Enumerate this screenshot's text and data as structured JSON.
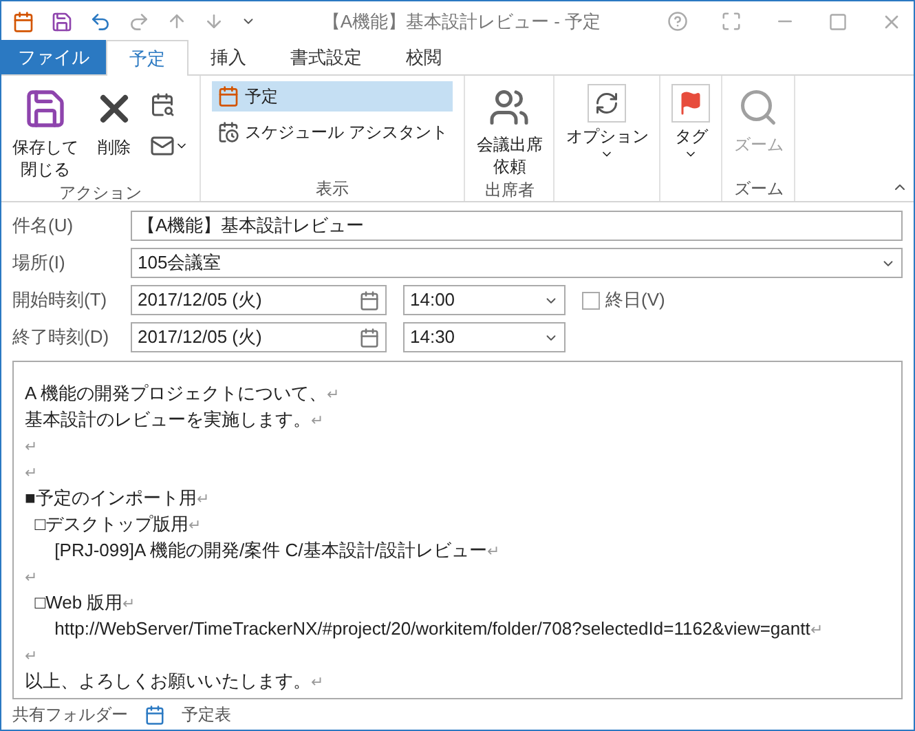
{
  "window": {
    "title": "【A機能】基本設計レビュー - 予定"
  },
  "ribbon_tabs": [
    {
      "label": "ファイル",
      "kind": "file",
      "selected": false
    },
    {
      "label": "予定",
      "kind": "tab",
      "selected": true
    },
    {
      "label": "挿入",
      "kind": "tab",
      "selected": false
    },
    {
      "label": "書式設定",
      "kind": "tab",
      "selected": false
    },
    {
      "label": "校閲",
      "kind": "tab",
      "selected": false
    }
  ],
  "ribbon_groups": [
    {
      "label": "アクション",
      "items": [
        {
          "kind": "save",
          "label": [
            "保存して",
            "閉じる"
          ]
        },
        {
          "kind": "delete",
          "label": "削除"
        },
        {
          "kind": "small-icons"
        }
      ]
    },
    {
      "label": "表示",
      "items": [
        {
          "kind": "view",
          "label": "予定",
          "selected": true
        },
        {
          "kind": "view",
          "label": "スケジュール アシスタント",
          "selected": false
        }
      ]
    },
    {
      "label": "出席者",
      "items": [
        {
          "kind": "meeting",
          "label": [
            "会議出席",
            "依頼"
          ]
        }
      ]
    },
    {
      "items": [
        {
          "kind": "options",
          "label": "オプション"
        }
      ]
    },
    {
      "items": [
        {
          "kind": "tags",
          "label": "タグ"
        }
      ]
    },
    {
      "label": "ズーム",
      "items": [
        {
          "kind": "zoom",
          "label": "ズーム",
          "disabled": true
        }
      ]
    }
  ],
  "form": {
    "subject": {
      "label": "件名(U)",
      "value": "【A機能】基本設計レビュー"
    },
    "location": {
      "label": "場所(I)",
      "value": "105会議室"
    },
    "start": {
      "label": "開始時刻(T)",
      "date": "2017/12/05 (火)",
      "time": "14:00"
    },
    "end": {
      "label": "終了時刻(D)",
      "date": "2017/12/05 (火)",
      "time": "14:30"
    },
    "all_day": {
      "label": "終日(V)",
      "checked": false
    }
  },
  "body": {
    "lines": [
      {
        "text": "A 機能の開発プロジェクトについて、",
        "mark": "↵"
      },
      {
        "text": "基本設計のレビューを実施します。",
        "mark": "↵"
      },
      {
        "mark": "↵"
      },
      {
        "mark": "↵"
      },
      {
        "text": "■予定のインポート用",
        "mark": "↵"
      },
      {
        "text": "  □デスクトップ版用",
        "mark": "↵"
      },
      {
        "text": "      [PRJ-099]A 機能の開発/案件 C/基本設計/設計レビュー",
        "mark": "↵"
      },
      {
        "mark": "↵"
      },
      {
        "text": "  □Web 版用",
        "mark": "↵"
      },
      {
        "text": "      http://WebServer/TimeTrackerNX/#project/20/workitem/folder/708?selectedId=1162&view=gantt",
        "mark": "↵"
      },
      {
        "mark": "↵"
      },
      {
        "text": "以上、よろしくお願いいたします。",
        "mark": "↵"
      }
    ]
  },
  "status_bar": {
    "folder": "共有フォルダー",
    "calendar": "予定表"
  }
}
